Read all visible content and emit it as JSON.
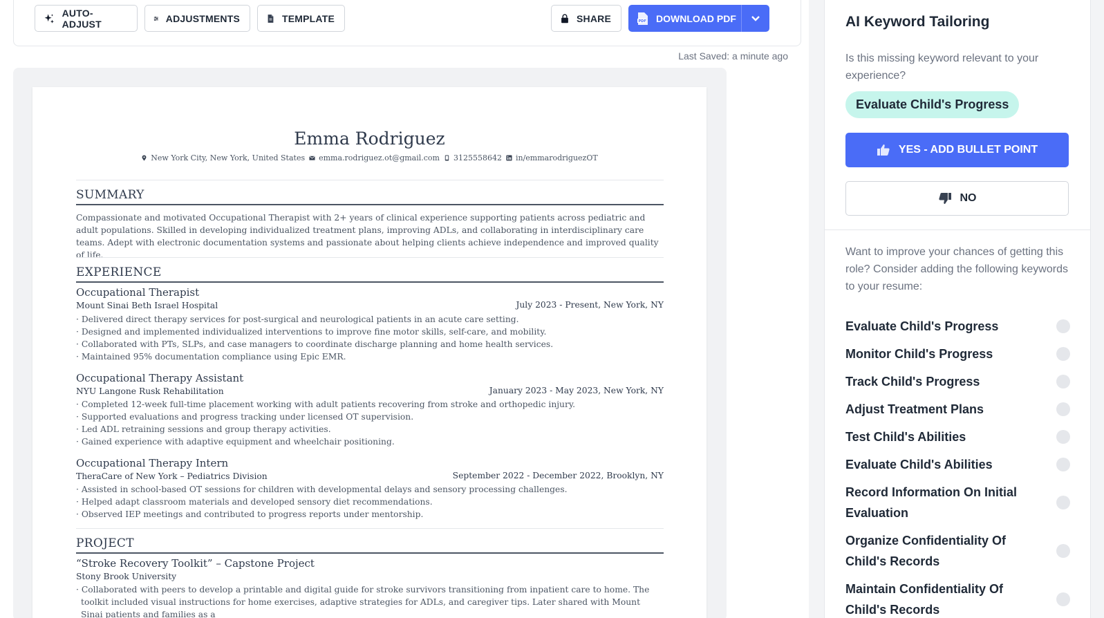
{
  "toolbar": {
    "auto_adjust": "AUTO-ADJUST",
    "adjustments": "ADJUSTMENTS",
    "template": "TEMPLATE",
    "share": "SHARE",
    "download_pdf": "DOWNLOAD PDF"
  },
  "last_saved": "Last Saved: a minute ago",
  "resume": {
    "name": "Emma Rodriguez",
    "contact": {
      "location": "New York City,  New York,  United States",
      "email": "emma.rodriguez.ot@gmail.com",
      "phone": "3125558642",
      "linkedin": "in/emmarodriguezOT"
    },
    "summary_title": "SUMMARY",
    "summary": "Compassionate and motivated Occupational Therapist with 2+ years of clinical experience supporting patients across pediatric and adult populations. Skilled in developing individualized treatment plans, improving ADLs, and collaborating in interdisciplinary care teams. Adept with electronic documentation systems and passionate about helping clients achieve independence and improved quality of life.",
    "experience_title": "EXPERIENCE",
    "jobs": [
      {
        "title": "Occupational Therapist",
        "company": "Mount Sinai Beth Israel Hospital",
        "dates": "July 2023 - Present,  New York, NY",
        "bullets": [
          "Delivered direct therapy services for post-surgical and neurological patients in an acute care setting.",
          "Designed and implemented individualized interventions to improve fine motor skills, self-care, and mobility.",
          "Collaborated with PTs, SLPs, and case managers to coordinate discharge planning and home health services.",
          "Maintained 95% documentation compliance using Epic EMR."
        ]
      },
      {
        "title": "Occupational Therapy Assistant",
        "company": "NYU Langone Rusk Rehabilitation",
        "dates": "January 2023 - May 2023,  New York, NY",
        "bullets": [
          "Completed 12-week full-time placement working with adult patients recovering from stroke and orthopedic injury.",
          "Supported evaluations and progress tracking under licensed OT supervision.",
          "Led ADL retraining sessions and group therapy activities.",
          "Gained experience with adaptive equipment and wheelchair positioning."
        ]
      },
      {
        "title": "Occupational Therapy Intern",
        "company": "TheraCare of New York – Pediatrics Division",
        "dates": "September 2022 - December 2022,  Brooklyn, NY",
        "bullets": [
          "Assisted in school-based OT sessions for children with developmental delays and sensory processing challenges.",
          "Helped adapt classroom materials and developed sensory diet recommendations.",
          "Observed IEP meetings and contributed to progress reports under mentorship."
        ]
      }
    ],
    "project_title": "PROJECT",
    "project": {
      "title": "“Stroke Recovery Toolkit” – Capstone Project",
      "org": "Stony Brook University",
      "bullet": "Collaborated with peers to develop a printable and digital guide for stroke survivors transitioning from inpatient care to home. The toolkit included visual instructions for home exercises, adaptive strategies for ADLs, and caregiver tips. Later shared with Mount Sinai patients and families as a"
    }
  },
  "panel": {
    "title": "AI Keyword Tailoring",
    "question": "Is this missing keyword relevant to your experience?",
    "current_keyword": "Evaluate Child's Progress",
    "yes_label": "YES - ADD BULLET POINT",
    "no_label": "NO",
    "intro": "Want to improve your chances of getting this role? Consider adding the following keywords to your resume:",
    "keywords": [
      "Evaluate Child's Progress",
      "Monitor Child's Progress",
      "Track Child's Progress",
      "Adjust Treatment Plans",
      "Test Child's Abilities",
      "Evaluate Child's Abilities",
      "Record Information On Initial Evaluation",
      "Organize Confidentiality Of Child's Records",
      "Maintain Confidentiality Of Child's Records"
    ]
  },
  "colors": {
    "accent": "#4a6cf7",
    "chip": "#c6f5ec"
  }
}
